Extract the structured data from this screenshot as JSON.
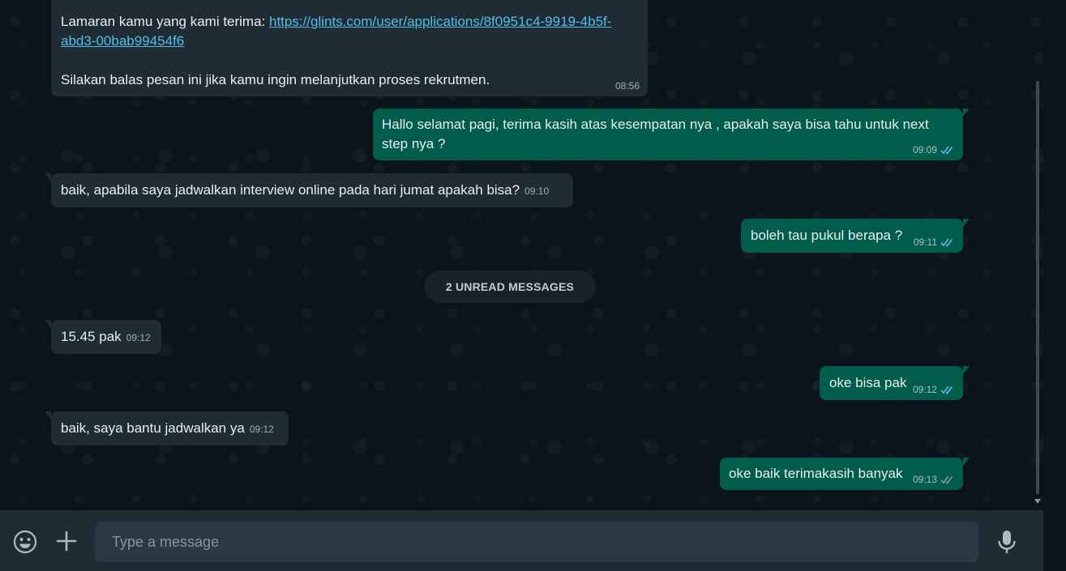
{
  "messages": {
    "m1": {
      "line1_prefix": "Lamaran kamu yang kami terima: ",
      "link_part1": "https://glints.com/user/applications/8f0951c4-9919-4b5f-",
      "link_part2": "abd3-00bab99454f6",
      "line3": "Silakan balas pesan ini jika kamu ingin melanjutkan proses rekrutmen.",
      "time": "08:56"
    },
    "m2": {
      "line1": "Hallo selamat pagi, terima kasih atas kesempatan nya , apakah saya bisa tahu untuk next",
      "line2": "step nya ?",
      "time": "09:09"
    },
    "m3": {
      "text": "baik, apabila saya jadwalkan interview online pada hari jumat apakah bisa?",
      "time": "09:10"
    },
    "m4": {
      "text": "boleh tau pukul berapa ?",
      "time": "09:11"
    },
    "m5": {
      "text": "15.45 pak",
      "time": "09:12"
    },
    "m6": {
      "text": "oke bisa pak",
      "time": "09:12"
    },
    "m7": {
      "text": "baik, saya bantu jadwalkan ya",
      "time": "09:12"
    },
    "m8": {
      "text": "oke baik terimakasih banyak",
      "time": "09:13"
    }
  },
  "unread_label": "2 UNREAD MESSAGES",
  "composer": {
    "placeholder": "Type a message"
  },
  "icons": {
    "emoji": "emoji-icon",
    "attach": "plus-icon",
    "mic": "mic-icon",
    "read": "double-check-icon"
  },
  "colors": {
    "incoming": "#202c33",
    "outgoing": "#005c4b",
    "tick": "#53bdeb"
  }
}
